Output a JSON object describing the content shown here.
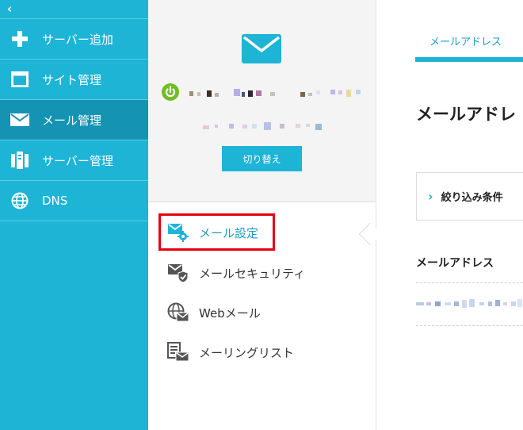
{
  "sidebar": {
    "collapse_glyph": "‹",
    "items": [
      {
        "label": "サーバー追加",
        "icon": "plus-icon"
      },
      {
        "label": "サイト管理",
        "icon": "window-icon"
      },
      {
        "label": "メール管理",
        "icon": "mail-icon",
        "active": true
      },
      {
        "label": "サーバー管理",
        "icon": "server-icon"
      },
      {
        "label": "DNS",
        "icon": "globe-icon"
      }
    ]
  },
  "account": {
    "switch_label": "切り替え",
    "status_color": "#71bd22"
  },
  "menu": {
    "items": [
      {
        "label": "メール設定",
        "icon": "mail-settings-icon",
        "selected": true
      },
      {
        "label": "メールセキュリティ",
        "icon": "mail-shield-icon"
      },
      {
        "label": "Webメール",
        "icon": "webmail-globe-icon"
      },
      {
        "label": "メーリングリスト",
        "icon": "mailing-list-icon"
      }
    ]
  },
  "main": {
    "tab_label": "メールアドレス",
    "title": "メールアドレ",
    "filter_label": "絞り込み条件",
    "column_header": "メールアドレス"
  },
  "colors": {
    "accent": "#1db4d6",
    "sidebar_active": "#1494b2",
    "highlight": "#e60012"
  }
}
